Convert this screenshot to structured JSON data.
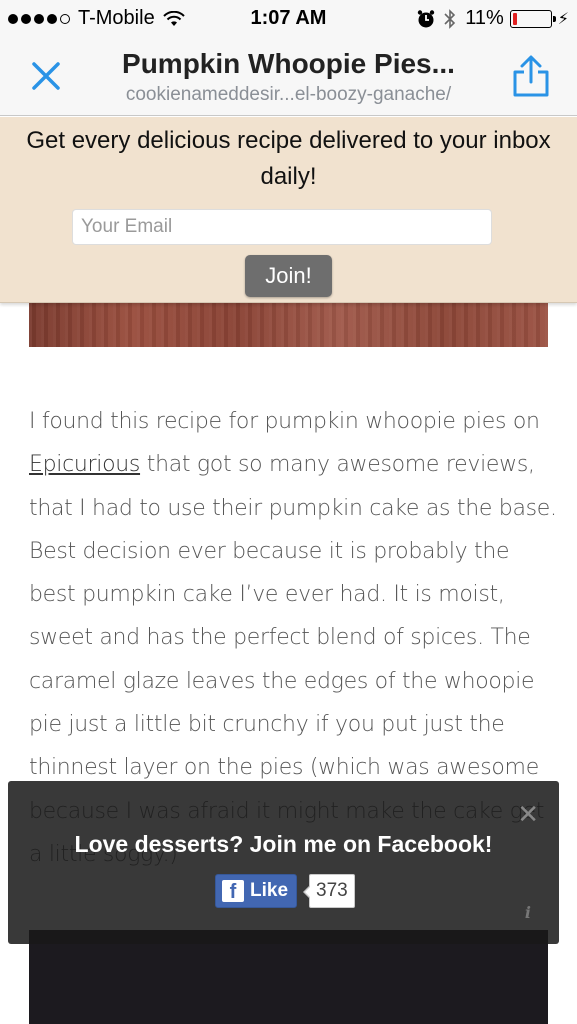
{
  "status_bar": {
    "carrier": "T-Mobile",
    "time": "1:07 AM",
    "battery_percent": "11%",
    "battery_level": 0.11,
    "icons": [
      "signal-dots-icon",
      "wifi-icon",
      "alarm-icon",
      "bluetooth-icon",
      "battery-icon",
      "charging-bolt-icon"
    ]
  },
  "nav": {
    "title": "Pumpkin Whoopie Pies...",
    "url": "cookienameddesir...el-boozy-ganache/",
    "close_icon": "close-icon",
    "share_icon": "share-icon",
    "accent_color": "#2a93e6"
  },
  "subscribe": {
    "headline": "Get every delicious recipe delivered to your inbox daily!",
    "email_placeholder": "Your Email",
    "email_value": "",
    "join_label": "Join!",
    "background_color": "#f1e2cf"
  },
  "article": {
    "text_before_link": "I found this recipe for pumpkin whoopie pies on ",
    "link_text": "Epicurious",
    "text_after_link": " that got so many awesome reviews, that I had to use their pumpkin cake as the base. Best decision ever because it is probably the best pumpkin cake I’ve ever had. It is moist, sweet and has the perfect blend of spices. The caramel glaze leaves the edges of the whoopie pie just a little bit crunchy if you put just the thinnest layer on the pies (which was awesome because I was afraid it might make the cake get a little soggy.)"
  },
  "facebook_popup": {
    "title": "Love desserts? Join me on Facebook!",
    "like_label": "Like",
    "like_count": "373",
    "close_icon": "close-icon",
    "info_icon": "info-icon",
    "brand_color": "#4267b2"
  }
}
